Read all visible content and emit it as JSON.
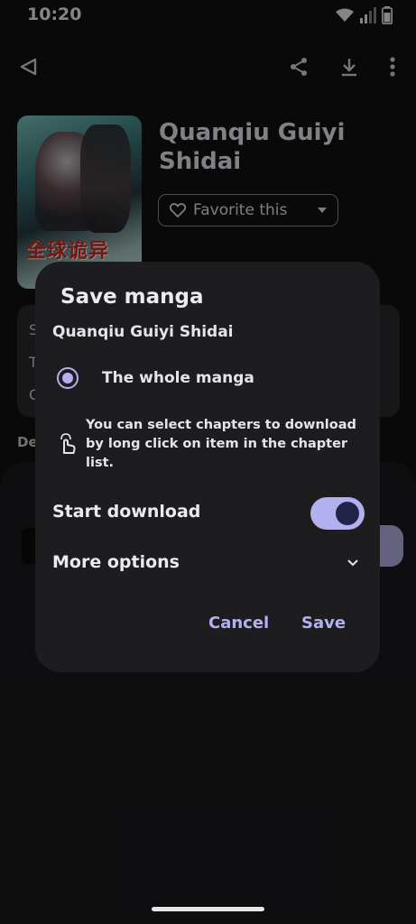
{
  "status_bar": {
    "time": "10:20"
  },
  "toolbar": {
    "back_icon": "back-triangle-icon",
    "share_icon": "share-icon",
    "download_icon": "download-icon",
    "more_icon": "more-vert-icon"
  },
  "manga": {
    "title": "Quanqiu Guiyi Shidai",
    "cover_text": "全球诡异",
    "favorite_label": "Favorite this"
  },
  "background": {
    "info_letters": [
      "S",
      "T",
      "C"
    ],
    "description_label": "De"
  },
  "dialog": {
    "title": "Save manga",
    "subtitle": "Quanqiu Guiyi Shidai",
    "option_whole": "The whole manga",
    "hint": "You can select chapters to download by long click on item in the chapter list.",
    "start_download_label": "Start download",
    "start_download_on": true,
    "more_options_label": "More options",
    "cancel_label": "Cancel",
    "save_label": "Save"
  },
  "colors": {
    "accent": "#b3b0f0",
    "dialog_bg": "#1d1d20",
    "background": "#111113"
  }
}
